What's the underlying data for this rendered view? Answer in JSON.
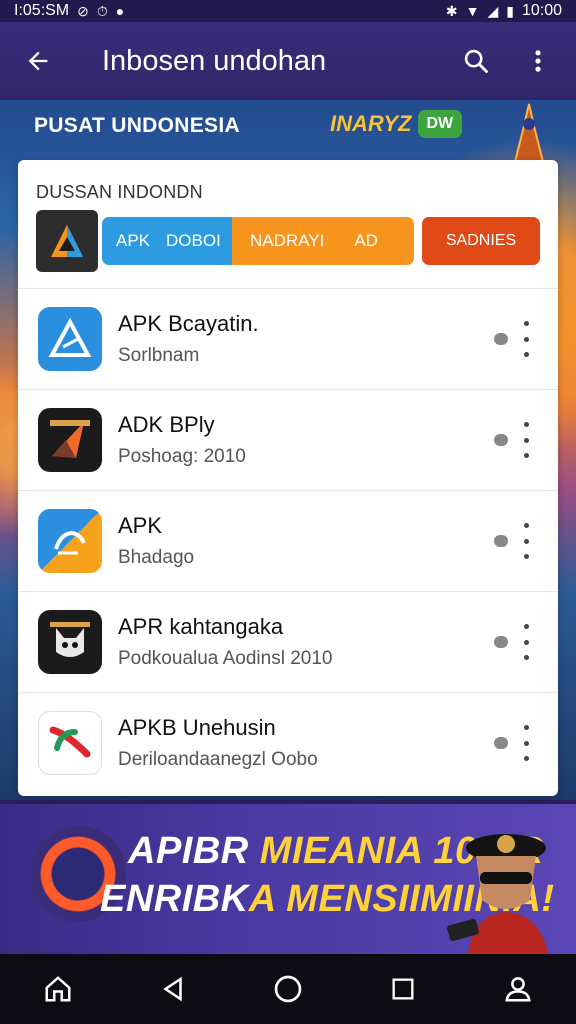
{
  "status_bar": {
    "time": "I:05:SM",
    "clock_right": "10:00"
  },
  "app_bar": {
    "title": "Inbosen undohan",
    "icons": [
      "back-arrow-icon",
      "search-icon",
      "more-vert-icon"
    ]
  },
  "hero": {
    "title": "PUSAT UNDONESIA",
    "logo_text": "INARYZ",
    "logo_badge": "DW"
  },
  "card": {
    "heading": "DUSSAN INDONDN",
    "filters": {
      "seg1_a": "APK",
      "seg1_b": "DOBOI",
      "seg2_a": "NADRAYI",
      "seg2_b": "AD",
      "button": "SADNIES"
    },
    "apps": [
      {
        "name": "APK Bcayatin.",
        "subtitle": "Sorlbnam",
        "icon": "triangle-app-icon",
        "color": "#2b8fe0"
      },
      {
        "name": "ADK BPly",
        "subtitle": "Poshoag:    2010",
        "icon": "arrow-app-icon",
        "color": "#1b1b1b"
      },
      {
        "name": "APK",
        "subtitle": "Bhadago",
        "icon": "swirl-app-icon",
        "color": "#2d8fe0"
      },
      {
        "name": "APR kahtangaka",
        "subtitle": "Podkoualua Aodinsl 2010",
        "icon": "cat-app-icon",
        "color": "#1b1b1b"
      },
      {
        "name": "APKB Unehusin",
        "subtitle": "Deriloandaanegzl Oobo",
        "icon": "leaf-app-icon",
        "color": "#ffffff"
      }
    ]
  },
  "banner": {
    "line1_a": "APIBR ",
    "line1_b": "MIEANIA 10-PR",
    "line2_a": "ENRIBK",
    "line2_b": "A MENSIIMIINIA!"
  },
  "nav_bar": {
    "icons": [
      "home-icon",
      "back-icon",
      "home-circle-icon",
      "recents-icon",
      "profile-icon"
    ]
  }
}
